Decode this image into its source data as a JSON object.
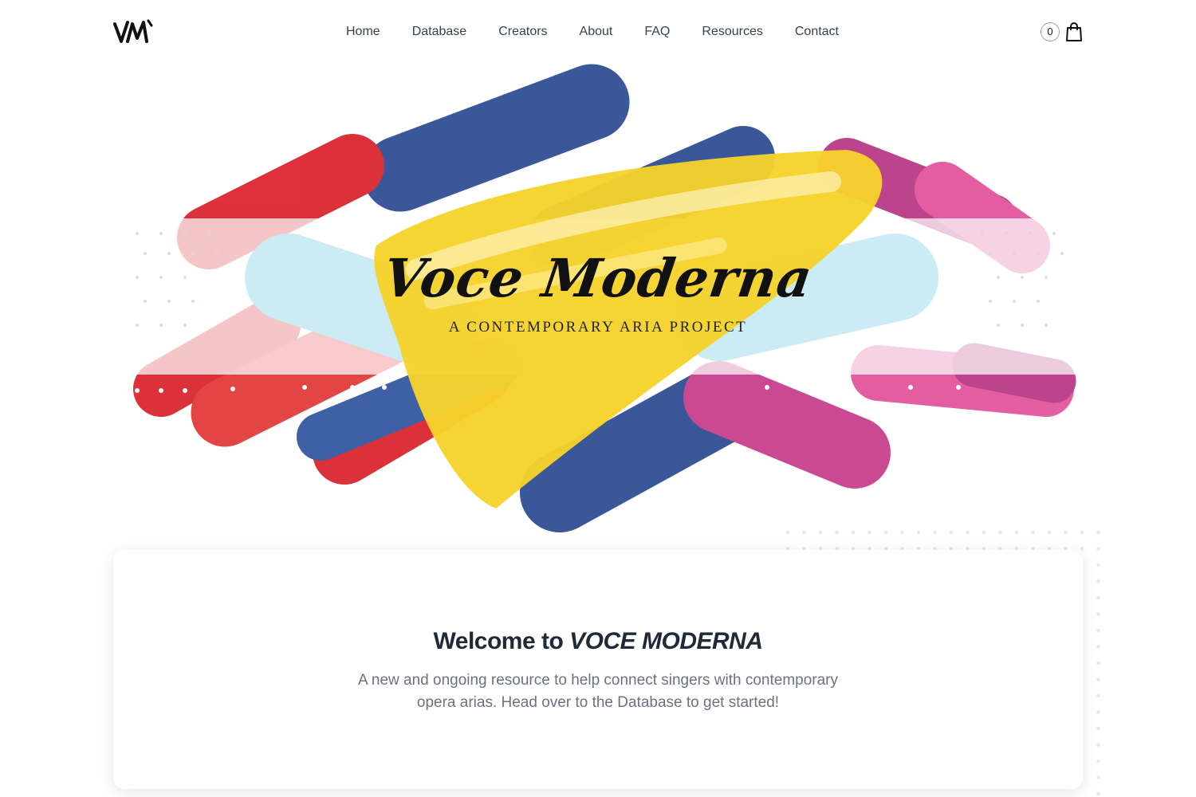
{
  "header": {
    "logo_alt": "VM",
    "nav": [
      "Home",
      "Database",
      "Creators",
      "About",
      "FAQ",
      "Resources",
      "Contact"
    ],
    "cart_count": "0"
  },
  "hero": {
    "title": "Voce Moderna",
    "subtitle": "A CONTEMPORARY ARIA PROJECT"
  },
  "welcome": {
    "prefix": "Welcome to ",
    "brand": "VOCE MODERNA",
    "intro": "A new and ongoing resource to help connect singers with contemporary opera arias. Head over to the Database to get started!"
  },
  "colors": {
    "red": "#d9282e",
    "blue": "#2f4f94",
    "yellow": "#f6d22b",
    "cyan": "#3cb7d6",
    "magenta": "#c8408e"
  }
}
